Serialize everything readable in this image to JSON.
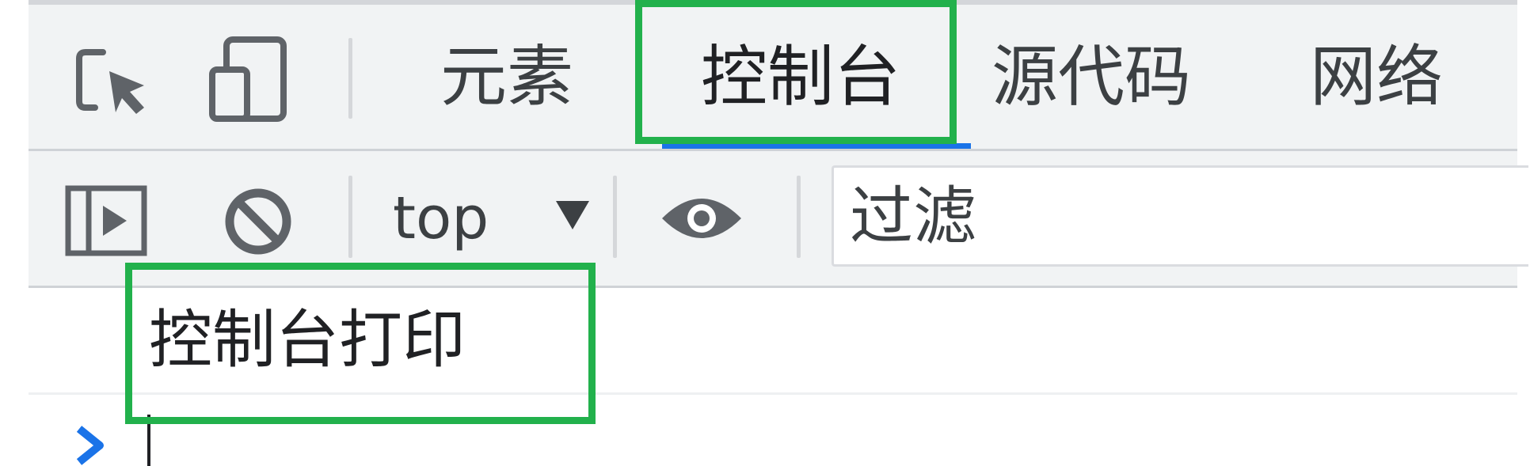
{
  "devtools": {
    "tabs": [
      {
        "label": "元素"
      },
      {
        "label": "控制台",
        "active": true
      },
      {
        "label": "源代码"
      },
      {
        "label": "网络"
      }
    ],
    "toolbar": {
      "context_label": "top",
      "filter_placeholder": "过滤"
    },
    "console": {
      "log_messages": [
        "控制台打印"
      ]
    }
  },
  "colors": {
    "panel_bg": "#f1f3f4",
    "active_tab_underline": "#1a73e8",
    "highlight_box": "#22b14c",
    "prompt_chevron": "#1a73e8",
    "icon_gray": "#5f6368"
  }
}
